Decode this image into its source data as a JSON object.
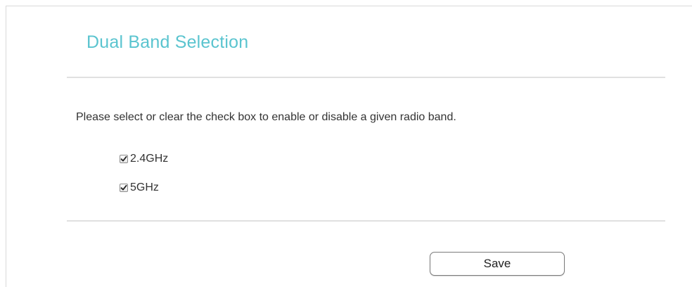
{
  "section": {
    "title": "Dual Band Selection",
    "title_color": "#5ac4cf",
    "description": "Please select or clear the check box to enable or disable a given radio band."
  },
  "bands": [
    {
      "label": "2.4GHz",
      "checked": true
    },
    {
      "label": "5GHz",
      "checked": true
    }
  ],
  "actions": {
    "save_label": "Save"
  }
}
